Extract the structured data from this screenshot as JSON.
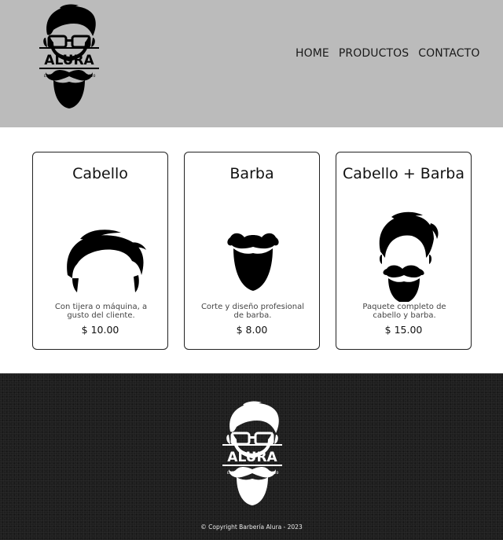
{
  "header": {
    "logo_text": "ALURA",
    "logo_left_small": "ESTD",
    "logo_right_small": "2020",
    "nav": [
      "HOME",
      "PRODUCTOS",
      "CONTACTO"
    ]
  },
  "products": [
    {
      "title": "Cabello",
      "description": "Con tijera o máquina, a gusto del cliente.",
      "price": "$ 10.00"
    },
    {
      "title": "Barba",
      "description": "Corte y diseño profesional de barba.",
      "price": "$ 8.00"
    },
    {
      "title": "Cabello + Barba",
      "description": "Paquete completo de cabello y barba.",
      "price": "$ 15.00"
    }
  ],
  "footer": {
    "logo_text": "ALURA",
    "logo_left_small": "ESTD",
    "logo_right_small": "2020",
    "copyright": "© Copyright Barbería Alura - 2023"
  },
  "colors": {
    "header_bg": "#bbbbbb",
    "footer_bg": "#1e1e1e",
    "card_border": "#222222"
  }
}
